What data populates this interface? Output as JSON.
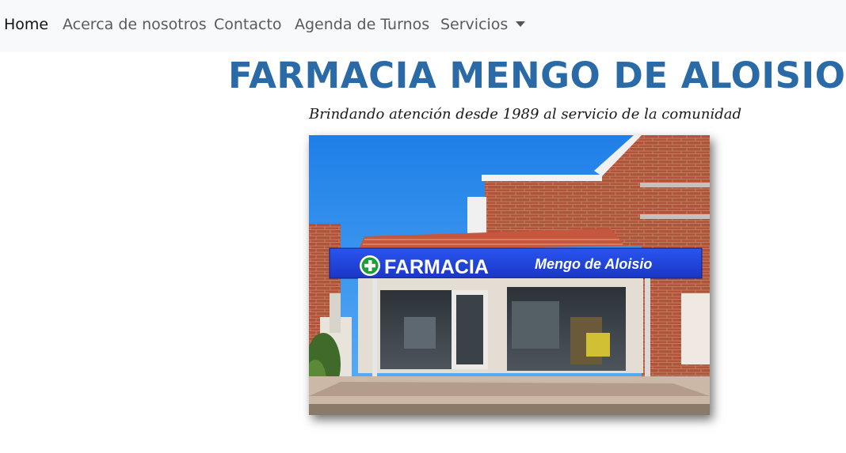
{
  "navbar": {
    "items": [
      {
        "label": "Home",
        "active": true
      },
      {
        "label": "Acerca de nosotros",
        "active": false
      },
      {
        "label": "Contacto",
        "active": false
      },
      {
        "label": "Agenda de Turnos",
        "active": false
      },
      {
        "label": "Servicios",
        "active": false,
        "dropdown": true
      }
    ]
  },
  "header": {
    "title": "FARMACIA MENGO DE ALOISIO",
    "tagline": "Brindando atención desde 1989 al servicio de la comunidad"
  },
  "photo": {
    "sign_left": "FARMACIA",
    "sign_right": "Mengo de Aloisio"
  },
  "colors": {
    "title": "#2a6aa6",
    "navbar_bg": "#f8f9fa",
    "sign_blue": "#1a3fd6"
  }
}
